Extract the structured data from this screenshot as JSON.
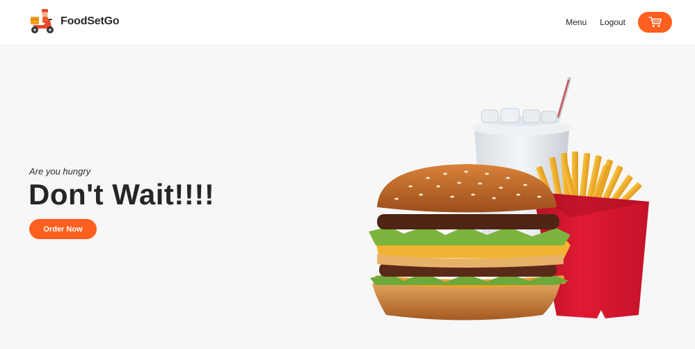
{
  "navbar": {
    "brand_name": "FoodSetGo",
    "logo_icon": "scooter-delivery-icon",
    "links": [
      {
        "label": "Menu"
      },
      {
        "label": "Logout"
      }
    ],
    "cart_icon": "cart-icon"
  },
  "hero": {
    "tagline": "Are you hungry",
    "title": "Don't Wait!!!!",
    "cta_label": "Order Now",
    "image": "burger-fries-drink-image"
  },
  "colors": {
    "accent": "#ff5f1f",
    "background": "#f7f7f7",
    "navbar_bg": "#ffffff",
    "text": "#262626"
  }
}
